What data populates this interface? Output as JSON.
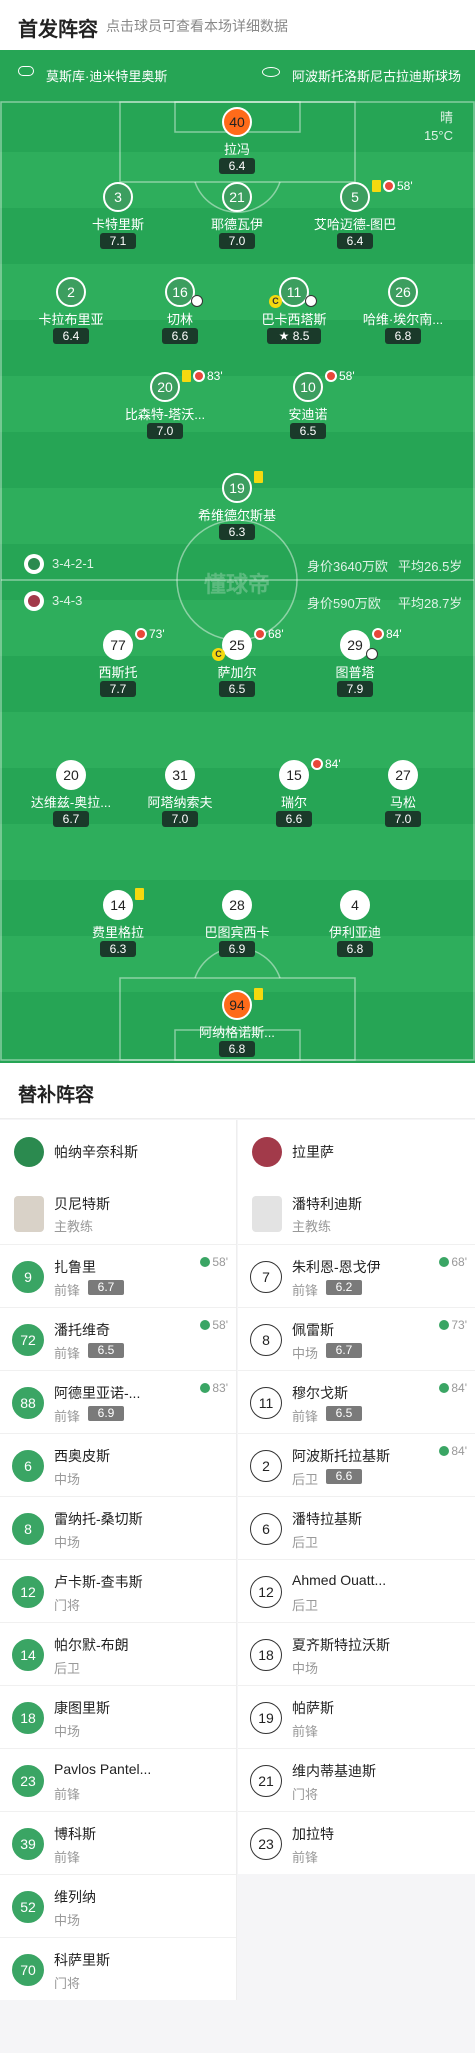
{
  "header": {
    "title": "首发阵容",
    "subtitle": "点击球员可查看本场详细数据"
  },
  "pitch": {
    "referee": "莫斯库·迪米特里奥斯",
    "stadium": "阿波斯托洛斯尼古拉迪斯球场",
    "weather": "晴",
    "temperature": "15°C",
    "watermark": "懂球帝",
    "home_formation": "3-4-2-1",
    "home_value": "身价3640万欧",
    "home_age": "平均26.5岁",
    "away_formation": "3-4-3",
    "away_value": "身价590万欧",
    "away_age": "平均28.7岁"
  },
  "home_players": [
    {
      "num": "40",
      "name": "拉冯",
      "rating": "6.4"
    },
    {
      "num": "3",
      "name": "卡特里斯",
      "rating": "7.1"
    },
    {
      "num": "21",
      "name": "耶德瓦伊",
      "rating": "7.0"
    },
    {
      "num": "5",
      "name": "艾哈迈德-图巴",
      "rating": "6.4",
      "sub": "58'"
    },
    {
      "num": "2",
      "name": "卡拉布里亚",
      "rating": "6.4"
    },
    {
      "num": "16",
      "name": "切林",
      "rating": "6.6"
    },
    {
      "num": "11",
      "name": "巴卡西塔斯",
      "rating": "8.5"
    },
    {
      "num": "26",
      "name": "哈维·埃尔南...",
      "rating": "6.8"
    },
    {
      "num": "20",
      "name": "比森特-塔沃...",
      "rating": "7.0",
      "sub": "83'"
    },
    {
      "num": "10",
      "name": "安迪诺",
      "rating": "6.5",
      "sub": "58'"
    },
    {
      "num": "19",
      "name": "希维德尔斯基",
      "rating": "6.3"
    }
  ],
  "away_players": [
    {
      "num": "77",
      "name": "西斯托",
      "rating": "7.7",
      "sub": "73'"
    },
    {
      "num": "25",
      "name": "萨加尔",
      "rating": "6.5",
      "sub": "68'"
    },
    {
      "num": "29",
      "name": "图普塔",
      "rating": "7.9",
      "sub": "84'"
    },
    {
      "num": "20",
      "name": "达维兹-奥拉...",
      "rating": "6.7"
    },
    {
      "num": "31",
      "name": "阿塔纳索夫",
      "rating": "7.0"
    },
    {
      "num": "15",
      "name": "瑞尔",
      "rating": "6.6",
      "sub": "84'"
    },
    {
      "num": "27",
      "name": "马松",
      "rating": "7.0"
    },
    {
      "num": "14",
      "name": "费里格拉",
      "rating": "6.3"
    },
    {
      "num": "28",
      "name": "巴图宾西卡",
      "rating": "6.9"
    },
    {
      "num": "4",
      "name": "伊利亚迪",
      "rating": "6.8"
    },
    {
      "num": "94",
      "name": "阿纳格诺斯...",
      "rating": "6.8"
    }
  ],
  "subs": {
    "title": "替补阵容",
    "home": {
      "team": "帕纳辛奈科斯",
      "coach": "贝尼特斯",
      "coach_role": "主教练",
      "players": [
        {
          "num": "9",
          "name": "扎鲁里",
          "pos": "前锋",
          "rating": "6.7",
          "time": "58'"
        },
        {
          "num": "72",
          "name": "潘托维奇",
          "pos": "前锋",
          "rating": "6.5",
          "time": "58'"
        },
        {
          "num": "88",
          "name": "阿德里亚诺-...",
          "pos": "前锋",
          "rating": "6.9",
          "time": "83'"
        },
        {
          "num": "6",
          "name": "西奥皮斯",
          "pos": "中场"
        },
        {
          "num": "8",
          "name": "雷纳托-桑切斯",
          "pos": "中场"
        },
        {
          "num": "12",
          "name": "卢卡斯-查韦斯",
          "pos": "门将"
        },
        {
          "num": "14",
          "name": "帕尔默-布朗",
          "pos": "后卫"
        },
        {
          "num": "18",
          "name": "康图里斯",
          "pos": "中场"
        },
        {
          "num": "23",
          "name": "Pavlos Pantel...",
          "pos": "前锋"
        },
        {
          "num": "39",
          "name": "博科斯",
          "pos": "前锋"
        },
        {
          "num": "52",
          "name": "维列纳",
          "pos": "中场"
        },
        {
          "num": "70",
          "name": "科萨里斯",
          "pos": "门将"
        }
      ]
    },
    "away": {
      "team": "拉里萨",
      "coach": "潘特利迪斯",
      "coach_role": "主教练",
      "players": [
        {
          "num": "7",
          "name": "朱利恩-恩戈伊",
          "pos": "前锋",
          "rating": "6.2",
          "time": "68'"
        },
        {
          "num": "8",
          "name": "佩雷斯",
          "pos": "中场",
          "rating": "6.7",
          "time": "73'"
        },
        {
          "num": "11",
          "name": "穆尔戈斯",
          "pos": "前锋",
          "rating": "6.5",
          "time": "84'"
        },
        {
          "num": "2",
          "name": "阿波斯托拉基斯",
          "pos": "后卫",
          "rating": "6.6",
          "time": "84'"
        },
        {
          "num": "6",
          "name": "潘特拉基斯",
          "pos": "后卫"
        },
        {
          "num": "12",
          "name": "Ahmed Ouatt...",
          "pos": "后卫"
        },
        {
          "num": "18",
          "name": "夏齐斯特拉沃斯",
          "pos": "中场"
        },
        {
          "num": "19",
          "name": "帕萨斯",
          "pos": "前锋"
        },
        {
          "num": "21",
          "name": "维内蒂基迪斯",
          "pos": "门将"
        },
        {
          "num": "23",
          "name": "加拉特",
          "pos": "前锋"
        }
      ]
    }
  }
}
